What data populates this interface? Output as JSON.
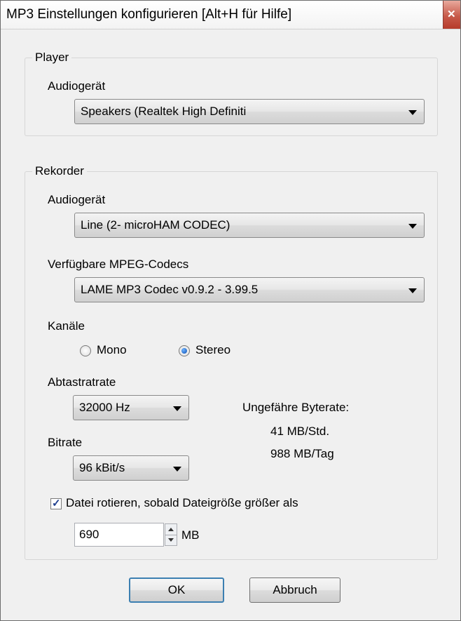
{
  "window": {
    "title": "MP3 Einstellungen konfigurieren [Alt+H für Hilfe]",
    "close_icon": "close-icon"
  },
  "player": {
    "group_label": "Player",
    "device_label": "Audiogerät",
    "device_value": "Speakers (Realtek High Definiti"
  },
  "recorder": {
    "group_label": "Rekorder",
    "device_label": "Audiogerät",
    "device_value": "Line (2- microHAM CODEC)",
    "codec_label": "Verfügbare MPEG-Codecs",
    "codec_value": "LAME MP3 Codec v0.9.2 - 3.99.5",
    "channels_label": "Kanäle",
    "channel_options": [
      "Mono",
      "Stereo"
    ],
    "channel_selected": "Stereo",
    "samplerate_label": "Abtastratrate",
    "samplerate_value": "32000 Hz",
    "bitrate_label": "Bitrate",
    "bitrate_value": "96 kBit/s",
    "byterate_label": "Ungefähre Byterate:",
    "byterate_per_hour": "41 MB/Std.",
    "byterate_per_day": "988 MB/Tag",
    "rotate_checked": true,
    "rotate_label": "Datei rotieren, sobald Dateigröße größer als",
    "rotate_size_value": "690",
    "rotate_size_unit": "MB"
  },
  "buttons": {
    "ok": "OK",
    "cancel": "Abbruch"
  },
  "colors": {
    "window_bg": "#f0f0f0",
    "close_button": "#c75a4a",
    "default_button_border": "#3c7fb1"
  }
}
